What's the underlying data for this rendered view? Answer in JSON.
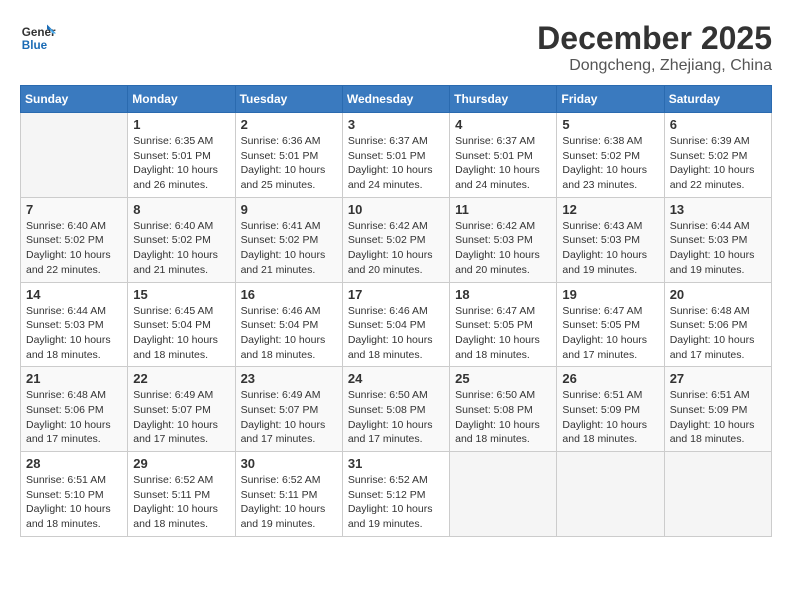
{
  "header": {
    "logo_line1": "General",
    "logo_line2": "Blue",
    "month_title": "December 2025",
    "subtitle": "Dongcheng, Zhejiang, China"
  },
  "days_of_week": [
    "Sunday",
    "Monday",
    "Tuesday",
    "Wednesday",
    "Thursday",
    "Friday",
    "Saturday"
  ],
  "weeks": [
    [
      {
        "day": "",
        "sunrise": "",
        "sunset": "",
        "daylight": ""
      },
      {
        "day": "1",
        "sunrise": "Sunrise: 6:35 AM",
        "sunset": "Sunset: 5:01 PM",
        "daylight": "Daylight: 10 hours and 26 minutes."
      },
      {
        "day": "2",
        "sunrise": "Sunrise: 6:36 AM",
        "sunset": "Sunset: 5:01 PM",
        "daylight": "Daylight: 10 hours and 25 minutes."
      },
      {
        "day": "3",
        "sunrise": "Sunrise: 6:37 AM",
        "sunset": "Sunset: 5:01 PM",
        "daylight": "Daylight: 10 hours and 24 minutes."
      },
      {
        "day": "4",
        "sunrise": "Sunrise: 6:37 AM",
        "sunset": "Sunset: 5:01 PM",
        "daylight": "Daylight: 10 hours and 24 minutes."
      },
      {
        "day": "5",
        "sunrise": "Sunrise: 6:38 AM",
        "sunset": "Sunset: 5:02 PM",
        "daylight": "Daylight: 10 hours and 23 minutes."
      },
      {
        "day": "6",
        "sunrise": "Sunrise: 6:39 AM",
        "sunset": "Sunset: 5:02 PM",
        "daylight": "Daylight: 10 hours and 22 minutes."
      }
    ],
    [
      {
        "day": "7",
        "sunrise": "Sunrise: 6:40 AM",
        "sunset": "Sunset: 5:02 PM",
        "daylight": "Daylight: 10 hours and 22 minutes."
      },
      {
        "day": "8",
        "sunrise": "Sunrise: 6:40 AM",
        "sunset": "Sunset: 5:02 PM",
        "daylight": "Daylight: 10 hours and 21 minutes."
      },
      {
        "day": "9",
        "sunrise": "Sunrise: 6:41 AM",
        "sunset": "Sunset: 5:02 PM",
        "daylight": "Daylight: 10 hours and 21 minutes."
      },
      {
        "day": "10",
        "sunrise": "Sunrise: 6:42 AM",
        "sunset": "Sunset: 5:02 PM",
        "daylight": "Daylight: 10 hours and 20 minutes."
      },
      {
        "day": "11",
        "sunrise": "Sunrise: 6:42 AM",
        "sunset": "Sunset: 5:03 PM",
        "daylight": "Daylight: 10 hours and 20 minutes."
      },
      {
        "day": "12",
        "sunrise": "Sunrise: 6:43 AM",
        "sunset": "Sunset: 5:03 PM",
        "daylight": "Daylight: 10 hours and 19 minutes."
      },
      {
        "day": "13",
        "sunrise": "Sunrise: 6:44 AM",
        "sunset": "Sunset: 5:03 PM",
        "daylight": "Daylight: 10 hours and 19 minutes."
      }
    ],
    [
      {
        "day": "14",
        "sunrise": "Sunrise: 6:44 AM",
        "sunset": "Sunset: 5:03 PM",
        "daylight": "Daylight: 10 hours and 18 minutes."
      },
      {
        "day": "15",
        "sunrise": "Sunrise: 6:45 AM",
        "sunset": "Sunset: 5:04 PM",
        "daylight": "Daylight: 10 hours and 18 minutes."
      },
      {
        "day": "16",
        "sunrise": "Sunrise: 6:46 AM",
        "sunset": "Sunset: 5:04 PM",
        "daylight": "Daylight: 10 hours and 18 minutes."
      },
      {
        "day": "17",
        "sunrise": "Sunrise: 6:46 AM",
        "sunset": "Sunset: 5:04 PM",
        "daylight": "Daylight: 10 hours and 18 minutes."
      },
      {
        "day": "18",
        "sunrise": "Sunrise: 6:47 AM",
        "sunset": "Sunset: 5:05 PM",
        "daylight": "Daylight: 10 hours and 18 minutes."
      },
      {
        "day": "19",
        "sunrise": "Sunrise: 6:47 AM",
        "sunset": "Sunset: 5:05 PM",
        "daylight": "Daylight: 10 hours and 17 minutes."
      },
      {
        "day": "20",
        "sunrise": "Sunrise: 6:48 AM",
        "sunset": "Sunset: 5:06 PM",
        "daylight": "Daylight: 10 hours and 17 minutes."
      }
    ],
    [
      {
        "day": "21",
        "sunrise": "Sunrise: 6:48 AM",
        "sunset": "Sunset: 5:06 PM",
        "daylight": "Daylight: 10 hours and 17 minutes."
      },
      {
        "day": "22",
        "sunrise": "Sunrise: 6:49 AM",
        "sunset": "Sunset: 5:07 PM",
        "daylight": "Daylight: 10 hours and 17 minutes."
      },
      {
        "day": "23",
        "sunrise": "Sunrise: 6:49 AM",
        "sunset": "Sunset: 5:07 PM",
        "daylight": "Daylight: 10 hours and 17 minutes."
      },
      {
        "day": "24",
        "sunrise": "Sunrise: 6:50 AM",
        "sunset": "Sunset: 5:08 PM",
        "daylight": "Daylight: 10 hours and 17 minutes."
      },
      {
        "day": "25",
        "sunrise": "Sunrise: 6:50 AM",
        "sunset": "Sunset: 5:08 PM",
        "daylight": "Daylight: 10 hours and 18 minutes."
      },
      {
        "day": "26",
        "sunrise": "Sunrise: 6:51 AM",
        "sunset": "Sunset: 5:09 PM",
        "daylight": "Daylight: 10 hours and 18 minutes."
      },
      {
        "day": "27",
        "sunrise": "Sunrise: 6:51 AM",
        "sunset": "Sunset: 5:09 PM",
        "daylight": "Daylight: 10 hours and 18 minutes."
      }
    ],
    [
      {
        "day": "28",
        "sunrise": "Sunrise: 6:51 AM",
        "sunset": "Sunset: 5:10 PM",
        "daylight": "Daylight: 10 hours and 18 minutes."
      },
      {
        "day": "29",
        "sunrise": "Sunrise: 6:52 AM",
        "sunset": "Sunset: 5:11 PM",
        "daylight": "Daylight: 10 hours and 18 minutes."
      },
      {
        "day": "30",
        "sunrise": "Sunrise: 6:52 AM",
        "sunset": "Sunset: 5:11 PM",
        "daylight": "Daylight: 10 hours and 19 minutes."
      },
      {
        "day": "31",
        "sunrise": "Sunrise: 6:52 AM",
        "sunset": "Sunset: 5:12 PM",
        "daylight": "Daylight: 10 hours and 19 minutes."
      },
      {
        "day": "",
        "sunrise": "",
        "sunset": "",
        "daylight": ""
      },
      {
        "day": "",
        "sunrise": "",
        "sunset": "",
        "daylight": ""
      },
      {
        "day": "",
        "sunrise": "",
        "sunset": "",
        "daylight": ""
      }
    ]
  ]
}
